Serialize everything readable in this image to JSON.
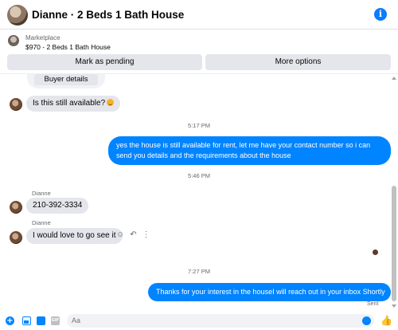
{
  "header": {
    "title": "Dianne · 2 Beds 1 Bath House",
    "info_icon": "i"
  },
  "listing": {
    "category": "Marketplace",
    "name": "$970 - 2 Beds 1 Bath House",
    "mark_pending_label": "Mark as pending",
    "more_options_label": "More options"
  },
  "chat": {
    "buyer_details_label": "Buyer details",
    "messages": [
      {
        "from": "them",
        "text": "Is this still available?"
      },
      {
        "time": "5:17 PM"
      },
      {
        "from": "me",
        "text": "yes the house is still available for rent, let me have your contact number so i can send you details and the requirements about the house"
      },
      {
        "time": "5:46 PM"
      },
      {
        "from": "them",
        "sender": "Dianne",
        "text": "210-392-3334"
      },
      {
        "from": "them",
        "sender": "Dianne",
        "text": "I would love to go see it"
      },
      {
        "time": "7:27 PM"
      },
      {
        "from": "me",
        "text": "Thanks for your interest in the houseI will reach out in your inbox Shortly",
        "status": "Sent"
      }
    ]
  },
  "composer": {
    "placeholder": "Aa",
    "gif_label": "GIF",
    "plus_label": "+",
    "like_label": "👍"
  },
  "colors": {
    "accent": "#0084ff",
    "incoming_bubble": "#e4e6eb"
  }
}
